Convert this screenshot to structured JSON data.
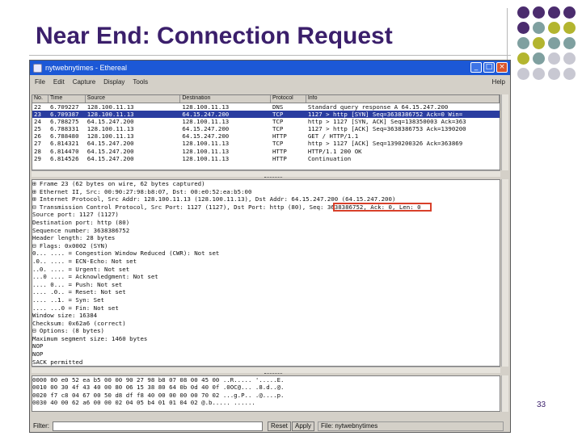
{
  "slide": {
    "title": "Near End: Connection Request",
    "page_number": "33",
    "dot_colors": [
      "#4b2c6e",
      "#7fa0a0",
      "#b3b52f",
      "#c8c8d2"
    ]
  },
  "window": {
    "title": "nytwebnytimes - Ethereal",
    "minimize": "_",
    "maximize": "□",
    "close": "×"
  },
  "menu": {
    "items": [
      "File",
      "Edit",
      "Capture",
      "Display",
      "Tools"
    ],
    "help": "Help"
  },
  "packet_list": {
    "headers": [
      "No.",
      "Time",
      "Source",
      "Destination",
      "Protocol",
      "Info"
    ],
    "rows": [
      [
        "22",
        "6.709227",
        "128.100.11.13",
        "128.100.11.13",
        "DNS",
        "Standard query response A 64.15.247.200"
      ],
      [
        "23",
        "6.709387",
        "128.100.11.13",
        "64.15.247.200",
        "TCP",
        "1127 > http [SYN] Seq=3638386752 Ack=0 Win="
      ],
      [
        "24",
        "6.788275",
        "64.15.247.200",
        "128.100.11.13",
        "TCP",
        "http > 1127 [SYN, ACK] Seq=138350003 Ack=363"
      ],
      [
        "25",
        "6.788331",
        "128.100.11.13",
        "64.15.247.200",
        "TCP",
        "1127 > http [ACK] Seq=3638386753 Ack=1390200"
      ],
      [
        "26",
        "6.788480",
        "128.100.11.13",
        "64.15.247.200",
        "HTTP",
        "GET / HTTP/1.1"
      ],
      [
        "27",
        "6.814321",
        "64.15.247.200",
        "128.100.11.13",
        "TCP",
        "http > 1127 [ACK] Seq=1390200326 Ack=363869"
      ],
      [
        "28",
        "6.814470",
        "64.15.247.200",
        "128.100.11.13",
        "HTTP",
        "HTTP/1.1 200 OK"
      ],
      [
        "29",
        "6.814526",
        "64.15.247.200",
        "128.100.11.13",
        "HTTP",
        "Continuation"
      ]
    ]
  },
  "details": [
    "⊞ Frame 23 (62 bytes on wire, 62 bytes captured)",
    "⊞ Ethernet II, Src: 00:90:27:98:b8:07, Dst: 00:e0:52:ea:b5:00",
    "⊞ Internet Protocol, Src Addr: 128.100.11.13 (128.100.11.13), Dst Addr: 64.15.247.200 (64.15.247.200)",
    "⊟ Transmission Control Protocol, Src Port: 1127 (1127), Dst Port: http (80), Seq: 3638386752, Ack: 0, Len: 0",
    "    Source port: 1127 (1127)",
    "    Destination port: http (80)",
    "    Sequence number: 3638386752",
    "    Header length: 28 bytes",
    "  ⊟ Flags: 0x0002 (SYN)",
    "      0... .... = Congestion Window Reduced (CWR): Not set",
    "      .0.. .... = ECN-Echo: Not set",
    "      ..0. .... = Urgent: Not set",
    "      ...0 .... = Acknowledgment: Not set",
    "      .... 0... = Push: Not set",
    "      .... .0.. = Reset: Not set",
    "      .... ..1. = Syn: Set",
    "      .... ...0 = Fin: Not set",
    "    Window size: 16384",
    "    Checksum: 0x62a6 (correct)",
    "  ⊟ Options: (8 bytes)",
    "      Maximum segment size: 1460 bytes",
    "      NOP",
    "      NOP",
    "      SACK permitted"
  ],
  "hex": [
    "0000  00 e0 52 ea b5 00 00 90  27 98 b8 07 08 00 45 00   ..R..... '.....E.",
    "0010  00 30 4f 43 40 00 80 06  15 38 80 64 0b 0d 40 0f   .0OC@... .8.d..@.",
    "0020  f7 c8 04 67 00 50 d8 df  f8 40 00 00 00 00 70 02   ...g.P.. .@....p.",
    "0030  40 00 62 a6 00 00 02 04  05 b4 01 01 04 02         @.b..... ......"
  ],
  "filter": {
    "label": "Filter:",
    "reset": "Reset",
    "apply": "Apply",
    "status": "File: nytwebnytimes"
  }
}
